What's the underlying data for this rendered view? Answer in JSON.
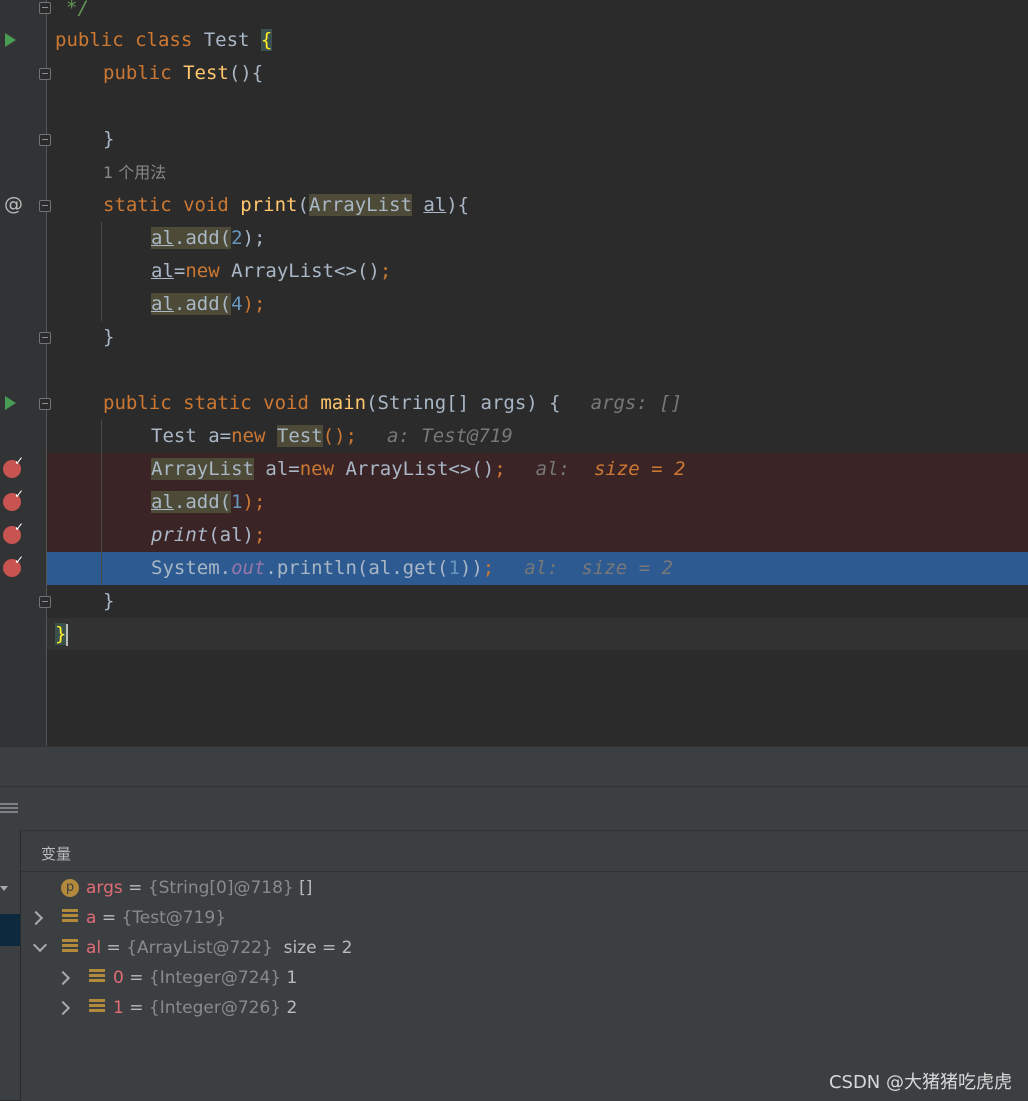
{
  "code": {
    "line0": "*/",
    "line1": {
      "kw": "public class ",
      "name": "Test ",
      "brace": "{"
    },
    "line2": {
      "kw": "public ",
      "fn": "Test",
      "rest": "(){"
    },
    "line4": "}",
    "usage": "1 个用法",
    "line6": {
      "kw": "static void ",
      "fn": "print",
      "p1": "(",
      "type": "ArrayList",
      "sp": " ",
      "param": "al",
      "p2": "){"
    },
    "line7": {
      "var": "al",
      "rest": ".add(",
      "num": "2",
      "end": ");"
    },
    "line8": {
      "var": "al",
      "eq": "=",
      "kw": "new ",
      "rest": "ArrayList<>()",
      "end": ";"
    },
    "line9": {
      "var": "al",
      "rest": ".add(",
      "num": "4",
      "end": ");"
    },
    "line10": "}",
    "line12": {
      "kw": "public static void ",
      "fn": "main",
      "rest": "(String[] args) {",
      "hint": "args: []"
    },
    "line13": {
      "a": "Test ",
      "b": "a",
      "c": "=",
      "kw": "new ",
      "type": "Test",
      "end": "();",
      "hint": "a: Test@719"
    },
    "line14": {
      "type": "ArrayList",
      "a": " al=",
      "kw": "new ",
      "rest": "ArrayList<>()",
      "end": ";",
      "hintk": "al:",
      "hintv": "size = 2"
    },
    "line15": {
      "var": "al",
      "rest": ".add(",
      "num": "1",
      "end": ");"
    },
    "line16": {
      "fn": "print",
      "rest": "(al)",
      "end": ";"
    },
    "line17": {
      "a": "System.",
      "stat": "out",
      "b": ".println(al.get(",
      "num": "1",
      "c": "))",
      "end": ";",
      "hint": "al:  size = 2"
    },
    "line18": "}",
    "line19": "}"
  },
  "panel": {
    "vars_title": "变量",
    "rows": [
      {
        "name": "args",
        "eq": " = ",
        "type": "{String[0]@718}",
        "val": " []"
      },
      {
        "name": "a",
        "eq": " = ",
        "type": "{Test@719}",
        "val": ""
      },
      {
        "name": "al",
        "eq": " = ",
        "type": "{ArrayList@722}",
        "val": "  size = 2"
      },
      {
        "name": "0",
        "eq": " = ",
        "type": "{Integer@724}",
        "val": " 1"
      },
      {
        "name": "1",
        "eq": " = ",
        "type": "{Integer@726}",
        "val": " 2"
      }
    ]
  },
  "watermark": "CSDN @大猪猪吃虎虎",
  "colors": {
    "keyword": "#cc7832",
    "function": "#ffc66d",
    "number": "#6897bb",
    "breakpoint": "#c75450",
    "current_line": "#2d5a91"
  }
}
